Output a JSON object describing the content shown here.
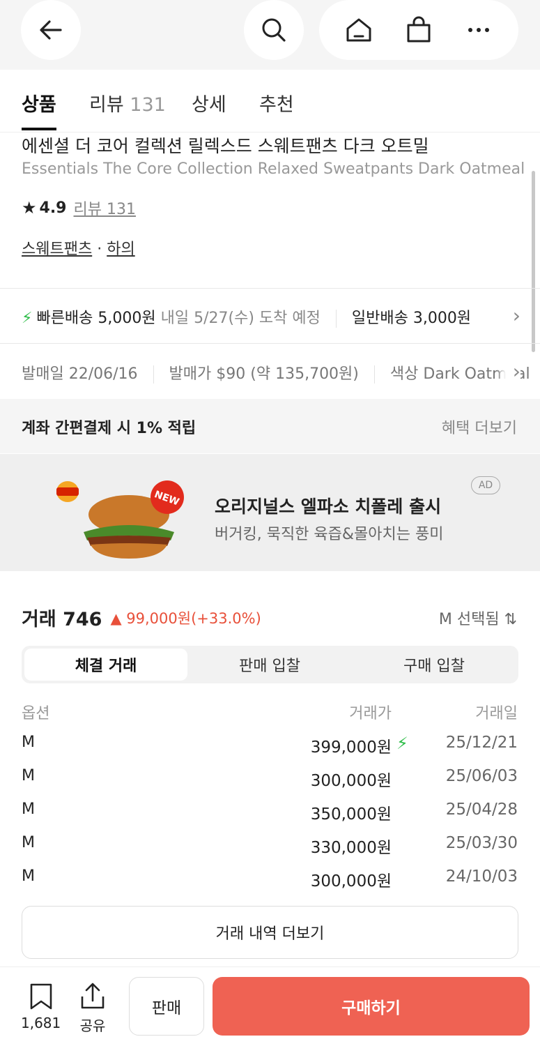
{
  "topbar": {
    "back_icon": "arrow-left-icon",
    "search_icon": "search-icon",
    "home_icon": "home-icon",
    "cart_icon": "shopping-bag-icon",
    "more_icon": "more-horizontal-icon"
  },
  "tabs": [
    {
      "label": "상품",
      "count": ""
    },
    {
      "label": "리뷰",
      "count": "131"
    },
    {
      "label": "상세",
      "count": ""
    },
    {
      "label": "추천",
      "count": ""
    }
  ],
  "product": {
    "title_ko": "에센셜 더 코어 컬렉션 릴렉스드 스웨트팬츠 다크 오트밀",
    "title_en": "Essentials The Core Collection Relaxed Sweatpants Dark Oatmeal",
    "rating": "4.9",
    "review_label": "리뷰 131",
    "category_1": "스웨트팬츠",
    "category_sep": "·",
    "category_2": "하의"
  },
  "shipping": {
    "fast_label": "빠른배송 5,000원",
    "fast_eta": "내일 5/27(수) 도착 예정",
    "normal_label": "일반배송 3,000원"
  },
  "release": {
    "date_label": "발매일",
    "date_value": "22/06/16",
    "price_label": "발매가",
    "price_value": "$90 (약 135,700원)",
    "color_label": "색상",
    "color_value": "Dark Oatmeal"
  },
  "benefit": {
    "label": "계좌 간편결제 시 1% 적립",
    "more": "혜택 더보기"
  },
  "ad": {
    "brand_logo_text": "BURGER KING",
    "new_badge": "NEW",
    "headline": "오리지널스 엘파소 치폴레 출시",
    "sub": "버거킹, 묵직한 육즙&몰아치는 풍미",
    "badge": "AD"
  },
  "trade": {
    "label": "거래 746",
    "change": "▲ 99,000원(+33.0%)",
    "size_selected": "M 선택됨",
    "tabs": [
      "체결 거래",
      "판매 입찰",
      "구매 입찰"
    ],
    "col_option": "옵션",
    "col_price": "거래가",
    "col_date": "거래일",
    "rows": [
      {
        "option": "M",
        "price": "399,000원",
        "date": "25/12/21",
        "fast": true
      },
      {
        "option": "M",
        "price": "300,000원",
        "date": "25/06/03",
        "fast": false
      },
      {
        "option": "M",
        "price": "350,000원",
        "date": "25/04/28",
        "fast": false
      },
      {
        "option": "M",
        "price": "330,000원",
        "date": "25/03/30",
        "fast": false
      },
      {
        "option": "M",
        "price": "300,000원",
        "date": "24/10/03",
        "fast": false
      }
    ],
    "more_button": "거래 내역 더보기"
  },
  "bottom": {
    "bookmark_count": "1,681",
    "share_label": "공유",
    "sell_label": "판매",
    "buy_label": "구매하기"
  },
  "colors": {
    "accent": "#ef6253",
    "up": "#e8503a",
    "fast": "#2fbd4a"
  }
}
